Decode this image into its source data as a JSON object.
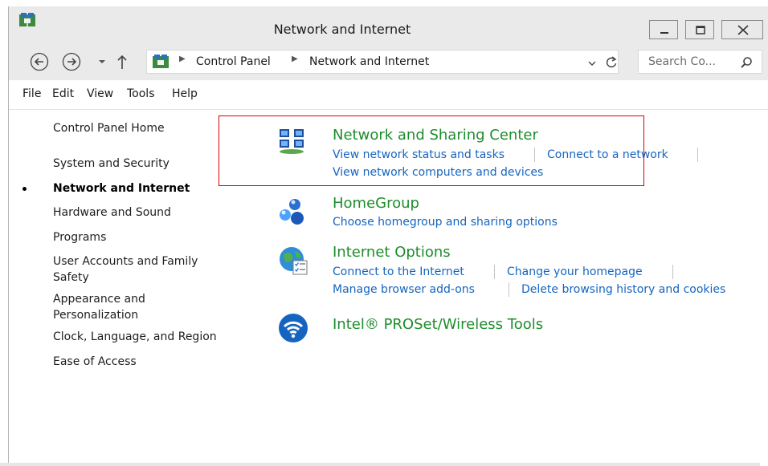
{
  "window": {
    "title": "Network and Internet"
  },
  "address": {
    "crumbs": [
      "Control Panel",
      "Network and Internet"
    ],
    "search_placeholder": "Search Co..."
  },
  "menu": {
    "file": "File",
    "edit": "Edit",
    "view": "View",
    "tools": "Tools",
    "help": "Help"
  },
  "left_nav": [
    "Control Panel Home",
    "System and Security",
    "Network and Internet",
    "Hardware and Sound",
    "Programs",
    "User Accounts and Family",
    "Safety",
    "Appearance and",
    "Personalization",
    "Clock, Language, and Region",
    "Ease of Access"
  ],
  "categories": {
    "sharing": {
      "title": "Network and Sharing Center",
      "links": [
        "View network status and tasks",
        "Connect to a network",
        "View network computers and devices"
      ]
    },
    "homegroup": {
      "title": "HomeGroup",
      "links": [
        "Choose homegroup and sharing options"
      ]
    },
    "internet": {
      "title": "Internet Options",
      "links": [
        "Connect to the Internet",
        "Change your homepage",
        "Manage browser add-ons",
        "Delete browsing history and cookies"
      ]
    },
    "intel": {
      "title": "Intel® PROSet/Wireless Tools"
    }
  },
  "colors": {
    "category_title": "#1e8d2c",
    "link": "#1565c0",
    "highlight_box": "#d40000"
  }
}
